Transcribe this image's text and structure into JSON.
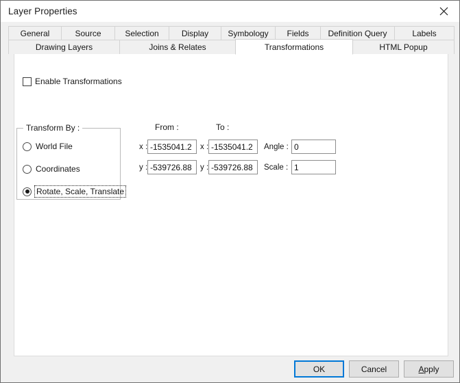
{
  "window": {
    "title": "Layer Properties",
    "close_icon": "close-icon"
  },
  "tabs": {
    "row1": [
      {
        "label": "General",
        "selected": false
      },
      {
        "label": "Source",
        "selected": false
      },
      {
        "label": "Selection",
        "selected": false
      },
      {
        "label": "Display",
        "selected": false
      },
      {
        "label": "Symbology",
        "selected": false
      },
      {
        "label": "Fields",
        "selected": false
      },
      {
        "label": "Definition Query",
        "selected": false
      },
      {
        "label": "Labels",
        "selected": false
      }
    ],
    "row2": [
      {
        "label": "Drawing Layers",
        "selected": false
      },
      {
        "label": "Joins & Relates",
        "selected": false
      },
      {
        "label": "Transformations",
        "selected": true
      },
      {
        "label": "HTML Popup",
        "selected": false
      }
    ]
  },
  "panel": {
    "enable_transformations": {
      "label": "Enable Transformations",
      "checked": false
    },
    "transform_by": {
      "legend": "Transform By :",
      "options": [
        {
          "label": "World File",
          "selected": false,
          "focused": false
        },
        {
          "label": "Coordinates",
          "selected": false,
          "focused": false
        },
        {
          "label": "Rotate, Scale, Translate",
          "selected": true,
          "focused": true
        }
      ]
    },
    "coords": {
      "from_header": "From :",
      "to_header": "To :",
      "x_label": "x :",
      "y_label": "y :",
      "from_x": "-1535041.2",
      "from_y": "-539726.88",
      "to_x": "-1535041.2",
      "to_y": "-539726.88",
      "angle_label": "Angle :",
      "angle_value": "0",
      "scale_label": "Scale :",
      "scale_value": "1"
    }
  },
  "buttons": {
    "ok": "OK",
    "cancel": "Cancel",
    "apply_accel": "A",
    "apply_rest": "pply"
  },
  "colors": {
    "accent": "#0078d7",
    "window_bg": "#f0f0f0",
    "panel_bg": "#ffffff",
    "field_border": "#8d8d8d"
  }
}
